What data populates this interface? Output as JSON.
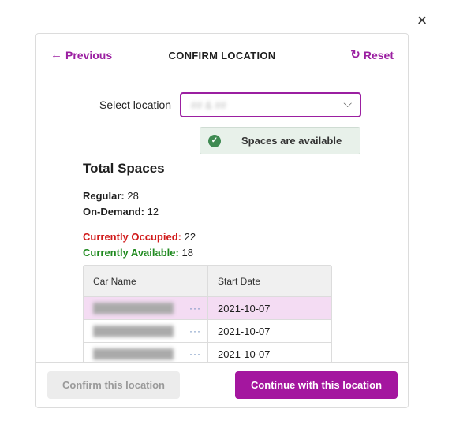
{
  "close_icon": "×",
  "header": {
    "previous_label": "Previous",
    "previous_icon": "←",
    "title": "CONFIRM LOCATION",
    "reset_label": "Reset",
    "reset_icon": "↻"
  },
  "select": {
    "label": "Select location",
    "value": "## & ##",
    "chevron": "⌵"
  },
  "availability": {
    "check": "✓",
    "text": "Spaces are available"
  },
  "totals": {
    "title": "Total Spaces",
    "regular_label": "Regular:",
    "regular_value": "28",
    "ondemand_label": "On-Demand:",
    "ondemand_value": "12",
    "occupied_label": "Currently Occupied:",
    "occupied_value": "22",
    "available_label": "Currently Available:",
    "available_value": "18"
  },
  "table": {
    "columns": [
      "Car Name",
      "Start Date"
    ],
    "rows": [
      {
        "name": "████████████",
        "actions": "···",
        "start_date": "2021-10-07"
      },
      {
        "name": "████████████",
        "actions": "···",
        "start_date": "2021-10-07"
      },
      {
        "name": "████████████",
        "actions": "···",
        "start_date": "2021-10-07"
      }
    ]
  },
  "footer": {
    "confirm_label": "Confirm this location",
    "continue_label": "Continue with this location"
  },
  "colors": {
    "accent": "#a4169f",
    "occupied": "#d11b1b",
    "available": "#1f8a1f"
  }
}
